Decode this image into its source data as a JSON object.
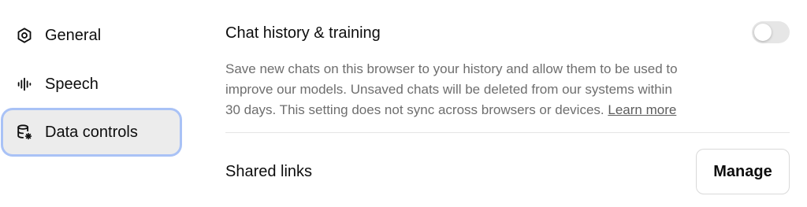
{
  "sidebar": {
    "items": [
      {
        "label": "General",
        "icon": "gear-icon",
        "selected": false
      },
      {
        "label": "Speech",
        "icon": "sound-wave-icon",
        "selected": false
      },
      {
        "label": "Data controls",
        "icon": "database-settings-icon",
        "selected": true
      }
    ]
  },
  "main": {
    "chat_history": {
      "title": "Chat history & training",
      "toggle_on": false,
      "description_lines": [
        "Save new chats on this browser to your history and allow them to be used to",
        "improve our models. Unsaved chats will be deleted from our systems within",
        "30 days. This setting does not sync across browsers or devices."
      ],
      "learn_more": "Learn more"
    },
    "shared_links": {
      "title": "Shared links",
      "button_label": "Manage"
    }
  },
  "colors": {
    "selected_bg": "#ececec",
    "focus_ring": "#a9c2f6",
    "toggle_off": "#e6e6e6",
    "muted_text": "#6e6e6e"
  }
}
